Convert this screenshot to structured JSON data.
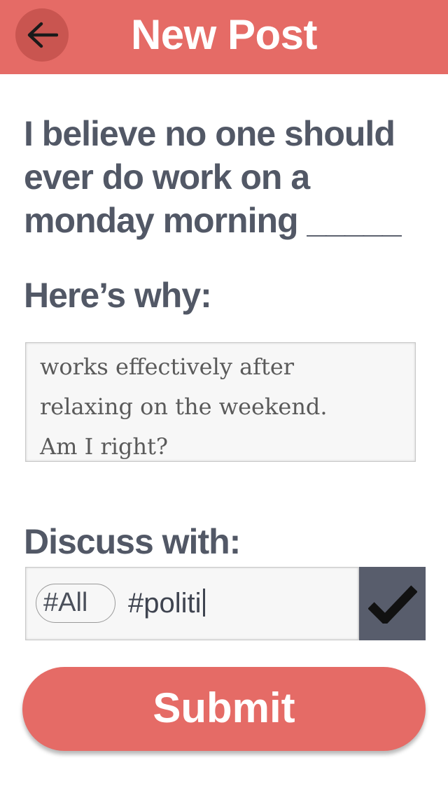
{
  "header": {
    "title": "New Post",
    "back_icon": "arrow-left-icon"
  },
  "post": {
    "belief_line1": "I believe no one should",
    "belief_line2": "ever do work on a",
    "belief_line3": "monday morning _____",
    "why_label": "Here’s why:",
    "reason_lines": [
      "works effectively after",
      "relaxing on the weekend.",
      "Am I right?"
    ]
  },
  "discuss": {
    "label": "Discuss with:",
    "chip": "#All",
    "typed_tag": "#politi",
    "confirm_icon": "checkmark-icon"
  },
  "submit_label": "Submit",
  "colors": {
    "accent": "#e56b66",
    "text": "#525866",
    "confirm_bg": "#585d6c"
  }
}
